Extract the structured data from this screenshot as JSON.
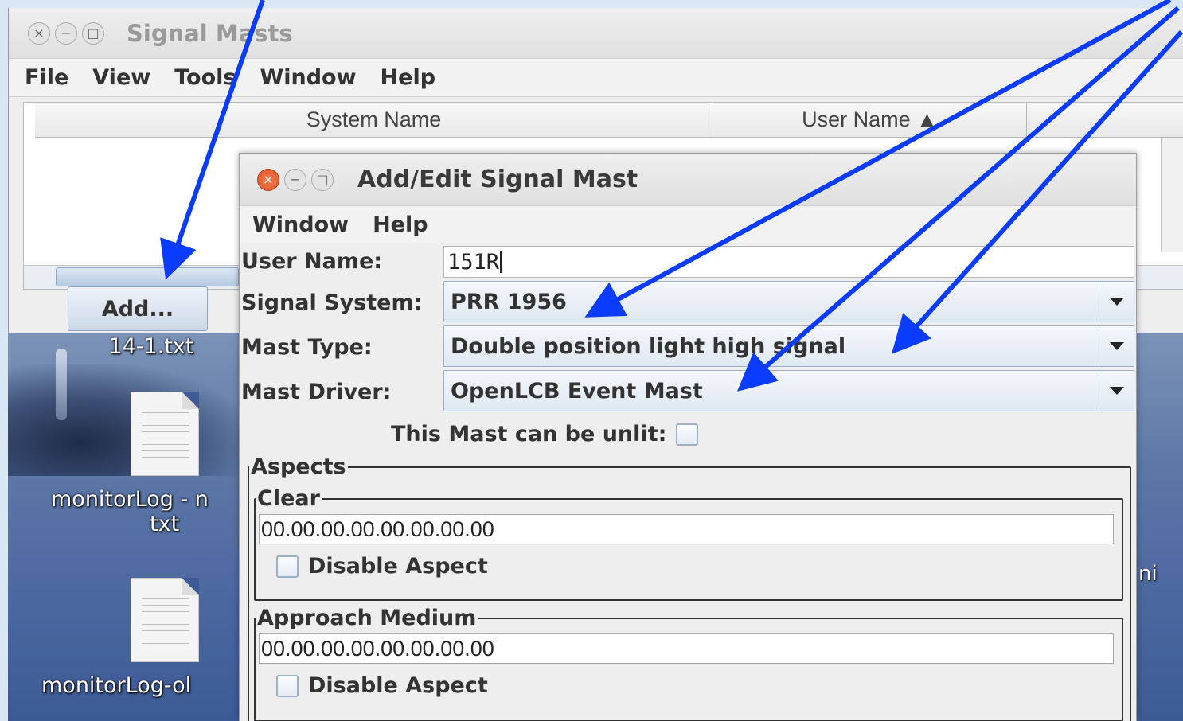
{
  "desktop": {
    "icons": [
      {
        "label": "14-1.txt"
      },
      {
        "label_line1": "monitorLog - n",
        "label_line2": "txt"
      },
      {
        "label": "monitorLog-ol"
      }
    ],
    "right_fragment": "ni"
  },
  "masts_window": {
    "title": "Signal Masts",
    "menu": [
      "File",
      "View",
      "Tools",
      "Window",
      "Help"
    ],
    "columns": [
      "System Name",
      "User Name ▲"
    ],
    "add_button": "Add..."
  },
  "dialog": {
    "title": "Add/Edit Signal Mast",
    "menu": [
      "Window",
      "Help"
    ],
    "user_name_label": "User Name:",
    "user_name_value": "151R",
    "signal_system_label": "Signal System:",
    "signal_system_value": "PRR 1956",
    "mast_type_label": "Mast Type:",
    "mast_type_value": "Double position light high signal",
    "mast_driver_label": "Mast Driver:",
    "mast_driver_value": "OpenLCB Event Mast",
    "unlit_label": "This Mast can be unlit:",
    "aspects_legend": "Aspects",
    "aspects": [
      {
        "name": "Clear",
        "event": "00.00.00.00.00.00.00.00",
        "disable_label": "Disable Aspect"
      },
      {
        "name": "Approach Medium",
        "event": "00.00.00.00.00.00.00.00",
        "disable_label": "Disable Aspect"
      }
    ]
  },
  "colors": {
    "arrow": "#0a3cff"
  }
}
